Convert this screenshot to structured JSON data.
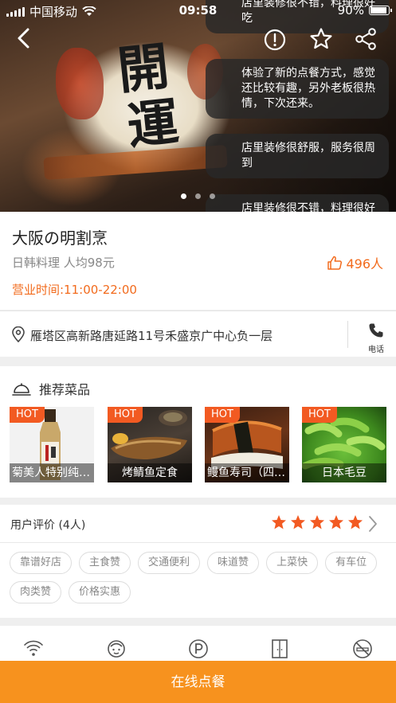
{
  "status_bar": {
    "carrier": "中国移动",
    "time": "09:58",
    "battery": "90%"
  },
  "hero": {
    "carousel_dots": 3,
    "active_dot": 0,
    "comments": [
      "店里装修很不错，料理很好吃",
      "体验了新的点餐方式，感觉还比较有趣，另外老板很热情，下次还来。",
      "店里装修很舒服，服务很周到",
      "店里装修很不错，料理很好吃"
    ]
  },
  "shop": {
    "name": "大阪の明割烹",
    "category_price": "日韩料理 人均98元",
    "likes": "496人",
    "hours": "营业时间:11:00-22:00",
    "address": "雁塔区高新路唐延路11号禾盛京广中心负一层",
    "phone_label": "电话"
  },
  "dishes": {
    "title": "推荐菜品",
    "hot_label": "HOT",
    "items": [
      {
        "name": "菊美人特别纯米酒"
      },
      {
        "name": "烤鲭鱼定食"
      },
      {
        "name": "鳗鱼寿司（四贯）"
      },
      {
        "name": "日本毛豆"
      }
    ]
  },
  "reviews": {
    "title": "用户评价 (4人)",
    "rating": 5,
    "tags": [
      "靠谱好店",
      "主食赞",
      "交通便利",
      "味道赞",
      "上菜快",
      "有车位",
      "肉类赞",
      "价格实惠"
    ]
  },
  "facilities": [
    "wifi-icon",
    "baby-seat-icon",
    "parking-icon",
    "private-room-icon",
    "no-smoking-icon"
  ],
  "order_button": "在线点餐",
  "colors": {
    "accent": "#f26b1d",
    "order_button": "#f7921e",
    "hot_badge": "#f25a22"
  }
}
